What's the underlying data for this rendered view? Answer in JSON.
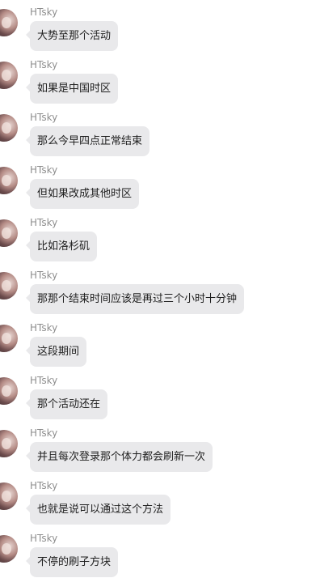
{
  "chat": {
    "messages": [
      {
        "sender": "HTsky",
        "text": "大势至那个活动"
      },
      {
        "sender": "HTsky",
        "text": "如果是中国时区"
      },
      {
        "sender": "HTsky",
        "text": "那么今早四点正常结束"
      },
      {
        "sender": "HTsky",
        "text": "但如果改成其他时区"
      },
      {
        "sender": "HTsky",
        "text": "比如洛杉矶"
      },
      {
        "sender": "HTsky",
        "text": "那那个结束时间应该是再过三个小时十分钟"
      },
      {
        "sender": "HTsky",
        "text": "这段期间"
      },
      {
        "sender": "HTsky",
        "text": "那个活动还在"
      },
      {
        "sender": "HTsky",
        "text": "并且每次登录那个体力都会刷新一次"
      },
      {
        "sender": "HTsky",
        "text": "也就是说可以通过这个方法"
      },
      {
        "sender": "HTsky",
        "text": "不停的刷子方块"
      }
    ]
  }
}
